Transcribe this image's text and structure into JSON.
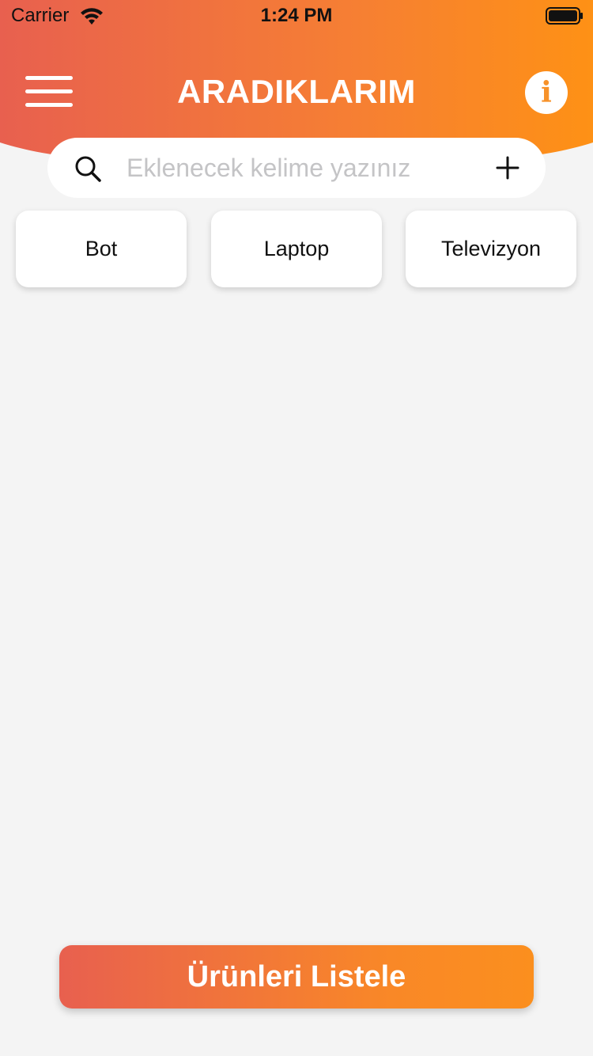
{
  "colors": {
    "gradient_start": "#e8604f",
    "gradient_end": "#fb8f1e",
    "background": "#f4f4f4",
    "accent": "#f7922a"
  },
  "status_bar": {
    "carrier": "Carrier",
    "time": "1:24 PM",
    "icons": [
      "wifi-icon",
      "battery-icon"
    ]
  },
  "header": {
    "title": "ARADIKLARIM",
    "menu_icon": "hamburger-menu-icon",
    "info_icon": "info-icon",
    "info_glyph": "i"
  },
  "search": {
    "placeholder": "Eklenecek kelime yazınız",
    "value": "",
    "search_icon": "search-icon",
    "add_icon": "plus-icon"
  },
  "keywords": [
    {
      "label": "Bot"
    },
    {
      "label": "Laptop"
    },
    {
      "label": "Televizyon"
    }
  ],
  "footer": {
    "list_button_label": "Ürünleri Listele"
  }
}
